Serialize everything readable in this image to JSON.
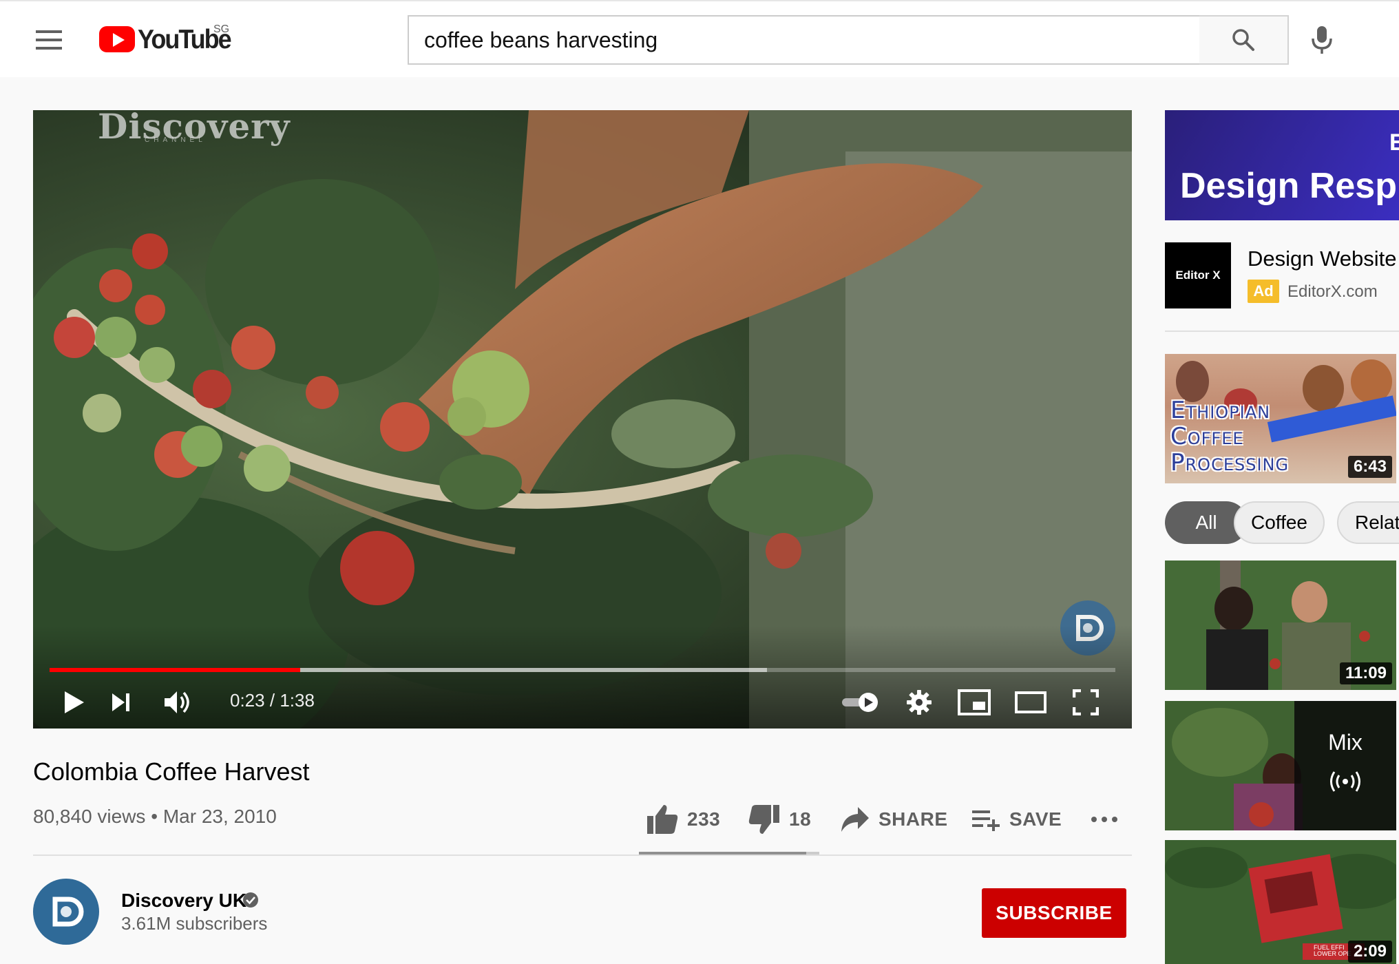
{
  "header": {
    "logo_text": "YouTube",
    "region": "SG",
    "search_value": "coffee beans harvesting",
    "search_placeholder": "Search"
  },
  "player": {
    "watermark": "Discovery",
    "watermark_sub": "CHANNEL",
    "current_time": "0:23",
    "duration": "1:38",
    "time_separator": "/",
    "progress_fraction": 0.235,
    "buffered_fraction": 0.673
  },
  "video": {
    "title": "Colombia Coffee Harvest",
    "views": "80,840 views",
    "date": "Mar 23, 2010",
    "likes": "233",
    "dislikes": "18",
    "share_label": "SHARE",
    "save_label": "SAVE",
    "like_fraction": 0.928
  },
  "channel": {
    "name": "Discovery UK",
    "subscribers": "3.61M subscribers",
    "subscribe_label": "SUBSCRIBE"
  },
  "sidebar": {
    "ad": {
      "banner_text": "Design Resp",
      "banner_corner": "E",
      "logo_text": "Editor X",
      "title": "Design Website",
      "badge": "Ad",
      "domain": "EditorX.com"
    },
    "first_video": {
      "lines": [
        "Ethiopian",
        "Coffee",
        "Processing"
      ],
      "duration": "6:43"
    },
    "chips": [
      "All",
      "Coffee",
      "Relat"
    ],
    "videos": [
      {
        "duration": "11:09"
      },
      {
        "mix_label": "Mix"
      },
      {
        "duration": "2:09",
        "overlay_text": "FUEL EFFI LOWER OPE"
      }
    ]
  },
  "colors": {
    "brand_red": "#ff0000",
    "subscribe_red": "#cc0000",
    "ad_badge": "#f5bd2a",
    "channel_blue": "#2f6a98"
  },
  "icons": [
    "menu-icon",
    "youtube-logo-icon",
    "search-icon",
    "mic-icon",
    "play-icon",
    "next-icon",
    "volume-icon",
    "autoplay-toggle-icon",
    "settings-gear-icon",
    "miniplayer-icon",
    "theater-mode-icon",
    "fullscreen-icon",
    "thumbs-up-icon",
    "thumbs-down-icon",
    "share-arrow-icon",
    "playlist-add-icon",
    "more-dots-icon",
    "verified-check-icon",
    "mix-radio-icon"
  ]
}
